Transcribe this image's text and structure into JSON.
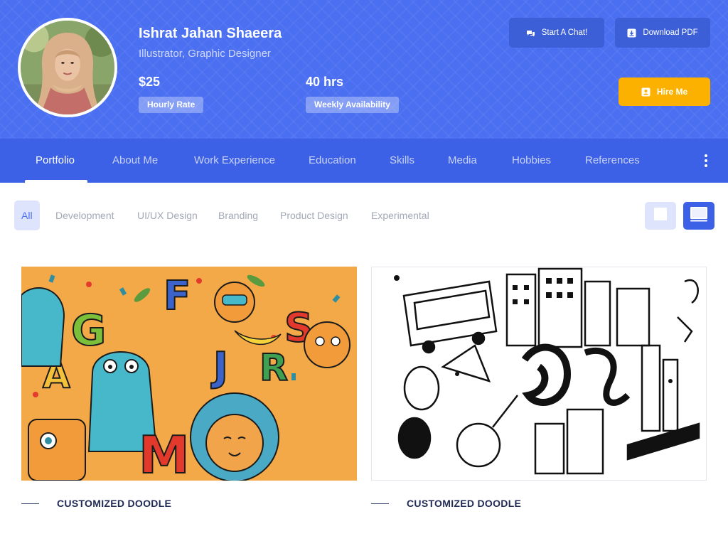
{
  "profile": {
    "name": "Ishrat Jahan Shaeera",
    "role": "Illustrator, Graphic Designer",
    "hourly_rate_value": "$25",
    "hourly_rate_label": "Hourly Rate",
    "availability_value": "40 hrs",
    "availability_label": "Weekly Availability"
  },
  "actions": {
    "chat_label": "Start A Chat!",
    "pdf_label": "Download PDF",
    "hire_label": "Hire Me"
  },
  "nav": {
    "items": [
      {
        "label": "Portfolio"
      },
      {
        "label": "About Me"
      },
      {
        "label": "Work Experience"
      },
      {
        "label": "Education"
      },
      {
        "label": "Skills"
      },
      {
        "label": "Media"
      },
      {
        "label": "Hobbies"
      },
      {
        "label": "References"
      }
    ],
    "active": "Portfolio"
  },
  "filters": {
    "items": [
      {
        "label": "All"
      },
      {
        "label": "Development"
      },
      {
        "label": "UI/UX Design"
      },
      {
        "label": "Branding"
      },
      {
        "label": "Product Design"
      },
      {
        "label": "Experimental"
      }
    ],
    "active": "All"
  },
  "portfolio": {
    "cards": [
      {
        "title": "CUSTOMIZED DOODLE",
        "image": "colorful-alphabet-doodle"
      },
      {
        "title": "CUSTOMIZED DOODLE",
        "image": "black-white-city-doodle"
      }
    ]
  },
  "icons": {
    "chat": "chat-icon",
    "download": "download-icon",
    "hire": "briefcase-icon",
    "more": "kebab-menu-icon",
    "grid_view": "grid-view-icon",
    "list_view": "list-view-icon"
  },
  "colors": {
    "header_bg": "#4b6ff1",
    "nav_bg": "#3c60e6",
    "accent": "#fcb100",
    "filter_active_bg": "#dee4fc",
    "title_text": "#1f2a55"
  }
}
